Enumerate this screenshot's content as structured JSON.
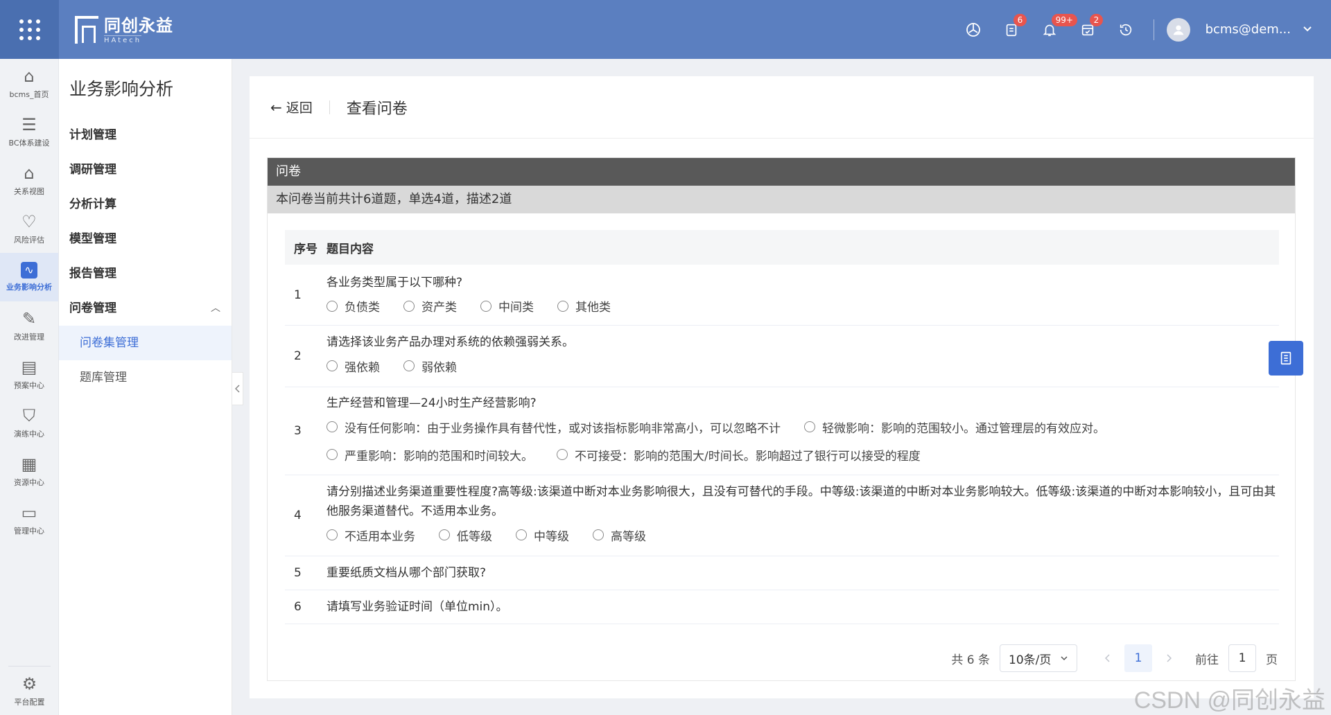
{
  "header": {
    "logo_title": "同创永益",
    "logo_sub": "HAtech",
    "icons": [
      {
        "name": "explore-icon",
        "badge": ""
      },
      {
        "name": "task-icon",
        "badge": "6"
      },
      {
        "name": "bell-icon",
        "badge": "99+"
      },
      {
        "name": "calendar-check-icon",
        "badge": "2"
      },
      {
        "name": "history-icon",
        "badge": ""
      }
    ],
    "user": "bcms@dem...",
    "chevron": "⌄"
  },
  "rail": {
    "items": [
      {
        "label": "bcms_首页",
        "icon": "⌂"
      },
      {
        "label": "BC体系建设",
        "icon": "☰"
      },
      {
        "label": "关系视图",
        "icon": "⌂"
      },
      {
        "label": "风险评估",
        "icon": "♡"
      },
      {
        "label": "业务影响分析",
        "icon": "∿",
        "active": true
      },
      {
        "label": "改进管理",
        "icon": "✎"
      },
      {
        "label": "预案中心",
        "icon": "▤"
      },
      {
        "label": "演练中心",
        "icon": "⛉"
      },
      {
        "label": "资源中心",
        "icon": "▦"
      },
      {
        "label": "管理中心",
        "icon": "▭"
      }
    ],
    "bottom": {
      "label": "平台配置",
      "icon": "⚙"
    }
  },
  "menu": {
    "title": "业务影响分析",
    "items": [
      "计划管理",
      "调研管理",
      "分析计算",
      "模型管理",
      "报告管理"
    ],
    "group": "问卷管理",
    "group_caret": "︿",
    "subitems": [
      "问卷集管理",
      "题库管理"
    ]
  },
  "page": {
    "back": "返回",
    "title": "查看问卷",
    "card_title": "问卷",
    "summary": "本问卷当前共计6道题，单选4道，描述2道",
    "col_no": "序号",
    "col_content": "题目内容"
  },
  "questions": [
    {
      "no": "1",
      "text": "各业务类型属于以下哪种?",
      "options": [
        "负债类",
        "资产类",
        "中间类",
        "其他类"
      ]
    },
    {
      "no": "2",
      "text": "请选择该业务产品办理对系统的依赖强弱关系。",
      "options": [
        "强依赖",
        "弱依赖"
      ]
    },
    {
      "no": "3",
      "text": "生产经营和管理—24小时生产经营影响?",
      "options": [
        "没有任何影响：由于业务操作具有替代性，或对该指标影响非常高小，可以忽略不计",
        "轻微影响：影响的范围较小。通过管理层的有效应对。",
        "严重影响：影响的范围和时间较大。",
        "不可接受：影响的范围大/时间长。影响超过了银行可以接受的程度"
      ]
    },
    {
      "no": "4",
      "text": "请分别描述业务渠道重要性程度?高等级:该渠道中断对本业务影响很大，且没有可替代的手段。中等级:该渠道的中断对本业务影响较大。低等级:该渠道的中断对本影响较小，且可由其他服务渠道替代。不适用本业务。",
      "options": [
        "不适用本业务",
        "低等级",
        "中等级",
        "高等级"
      ]
    },
    {
      "no": "5",
      "text": "重要纸质文档从哪个部门获取?",
      "options": []
    },
    {
      "no": "6",
      "text": "请填写业务验证时间（单位min）。",
      "options": []
    }
  ],
  "pager": {
    "total": "共 6 条",
    "size": "10条/页",
    "current": "1",
    "goto": "前往",
    "goto_value": "1",
    "unit": "页"
  },
  "watermark": "CSDN @同创永益"
}
